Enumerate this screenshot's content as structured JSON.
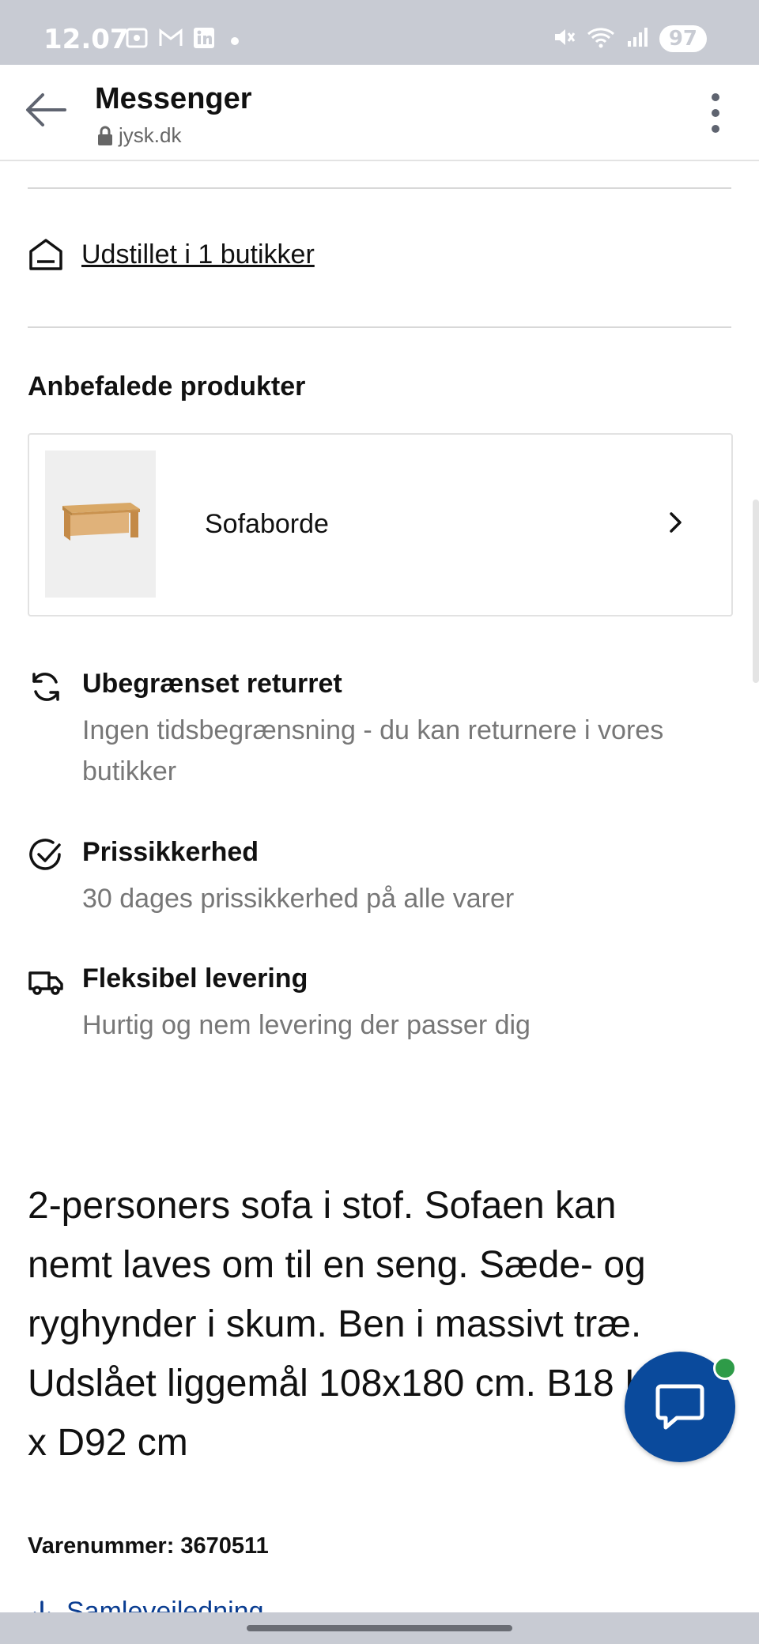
{
  "status_bar": {
    "time": "12.07",
    "notification_icons": [
      "screen-record-icon",
      "gmail-icon",
      "linkedin-icon"
    ],
    "battery": "97"
  },
  "app_bar": {
    "title": "Messenger",
    "url": "jysk.dk"
  },
  "stores": {
    "link_text": "Udstillet i 1 butikker"
  },
  "recommended": {
    "title": "Anbefalede produkter",
    "items": [
      {
        "label": "Sofaborde",
        "image": "coffee-table-image"
      }
    ]
  },
  "features": [
    {
      "icon": "refresh-icon",
      "title": "Ubegrænset returret",
      "description": "Ingen tidsbegrænsning - du kan returnere i vores butikker"
    },
    {
      "icon": "check-circle-icon",
      "title": "Prissikkerhed",
      "description": "30 dages prissikkerhed på alle varer"
    },
    {
      "icon": "truck-icon",
      "title": "Fleksibel levering",
      "description": "Hurtig og nem levering der passer dig"
    }
  ],
  "description": "2-personers sofa i stof. Sofaen kan nemt laves om til en seng. Sæde- og ryghynder i skum. Ben i massivt træ. Udslået liggemål 108x180 cm. B18 H82 x D92 cm",
  "sku": "Varenummer: 3670511",
  "assembly": {
    "label": "Samlevejledning"
  },
  "colors": {
    "link_blue": "#0a3d91",
    "chat_blue": "#0a4a9c",
    "online_green": "#2e9b48"
  }
}
